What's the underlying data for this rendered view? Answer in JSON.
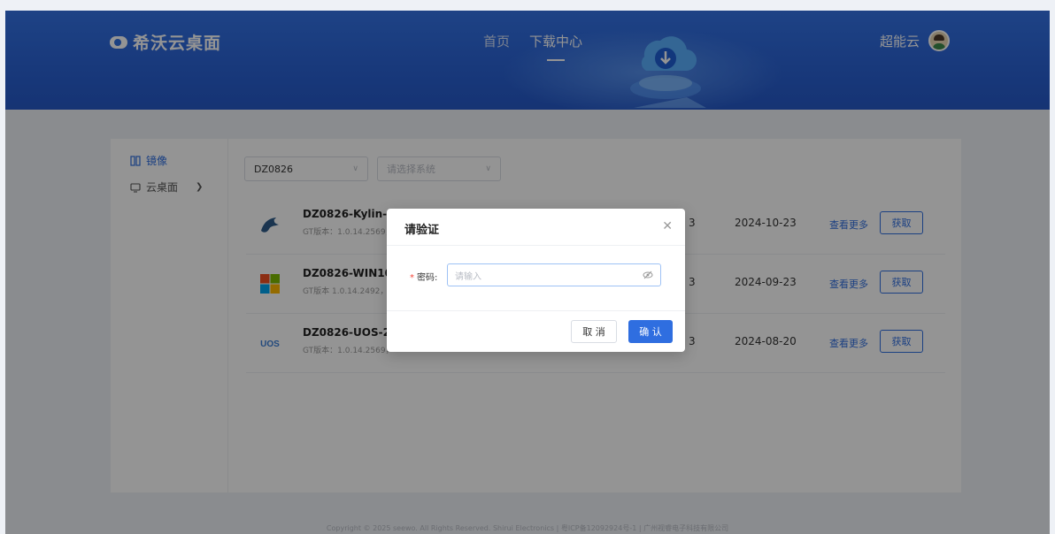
{
  "header": {
    "brand_name": "希沃云桌面",
    "nav": [
      {
        "label": "首页",
        "active": false
      },
      {
        "label": "下载中心",
        "active": true
      }
    ],
    "user_name": "超能云"
  },
  "sidebar": {
    "items": [
      {
        "label": "镜像",
        "icon": "image-icon",
        "active": true
      },
      {
        "label": "云桌面",
        "icon": "desktop-icon",
        "active": false,
        "expandable": true
      }
    ]
  },
  "filters": {
    "model_select": {
      "value": "DZ0826"
    },
    "system_select": {
      "placeholder": "请选择系统"
    }
  },
  "list": {
    "rows": [
      {
        "icon": "kylin-logo-icon",
        "title": "DZ0826-Kylin-2024",
        "subtitle": "GT版本：1.0.14.2569，",
        "mid": "3",
        "date": "2024-10-23",
        "more": "查看更多",
        "action": "获取"
      },
      {
        "icon": "windows-logo-icon",
        "title": "DZ0826-WIN10-20",
        "subtitle": "GT版本 1.0.14.2492，",
        "mid": "3",
        "date": "2024-09-23",
        "more": "查看更多",
        "action": "获取"
      },
      {
        "icon": "uos-logo-icon",
        "title": "DZ0826-UOS-2024",
        "subtitle": "GT版本：1.0.14.2569，",
        "mid": "3",
        "date": "2024-08-20",
        "more": "查看更多",
        "action": "获取"
      }
    ]
  },
  "footer": {
    "text": "Copyright © 2025 seewo. All Rights Reserved. Shirui Electronics | 粤ICP备12092924号-1 | 广州视睿电子科技有限公司"
  },
  "modal": {
    "title": "请验证",
    "field_label": "密码:",
    "password_placeholder": "请输入",
    "cancel_label": "取 消",
    "ok_label": "确 认"
  },
  "colors": {
    "primary": "#2f6ee0",
    "header_bg": "#2f6ee0",
    "required": "#f5483b"
  }
}
